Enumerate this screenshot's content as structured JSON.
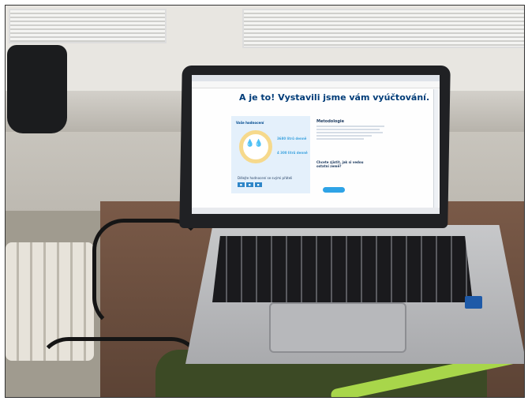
{
  "screen": {
    "headline": "A je to! Vystavili jsme vám vyúčtování.",
    "left_card": {
      "title": "Vaše hodnocení",
      "stat_1": "3680 litrů denně",
      "stat_2": "4 300 litrů denně"
    },
    "share_text": "Dělejte hodnocení se svými přáteli",
    "right_card": {
      "title": "Metodologie",
      "question": "Chcete zjistit, jak si vedou ostatní země?"
    }
  },
  "colors": {
    "accent": "#2ea3e6",
    "headline": "#003c78"
  }
}
